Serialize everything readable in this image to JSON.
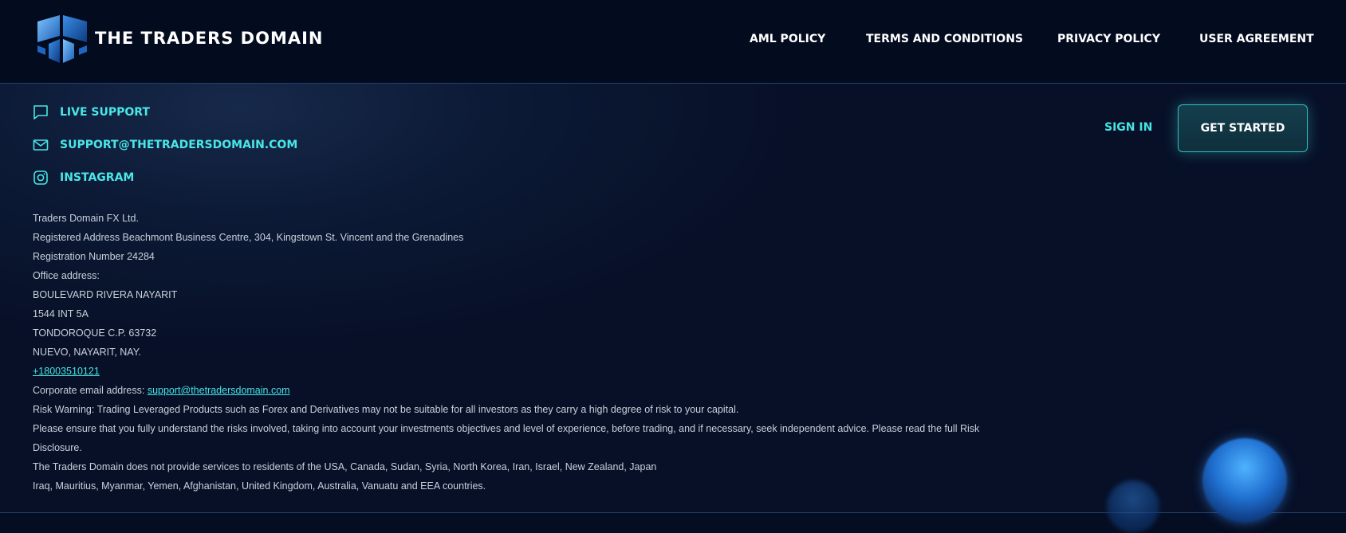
{
  "header": {
    "brand": "THE TRADERS DOMAIN",
    "nav": {
      "aml": "AML POLICY",
      "terms": "TERMS AND CONDITIONS",
      "privacy": "PRIVACY POLICY",
      "agreement": "USER AGREEMENT"
    }
  },
  "contacts": {
    "live_support": "LIVE SUPPORT",
    "email": "SUPPORT@THETRADERSDOMAIN.COM",
    "instagram": "INSTAGRAM"
  },
  "auth": {
    "sign_in": "SIGN IN",
    "get_started": "GET STARTED"
  },
  "company": {
    "name": "Traders Domain FX Ltd.",
    "registered_address": "Registered Address Beachmont Business Centre, 304, Kingstown St. Vincent and the Grenadines",
    "registration_number": "Registration Number 24284",
    "office_label": "Office address:",
    "office_line1": "BOULEVARD RIVERA NAYARIT",
    "office_line2": "1544 INT 5A",
    "office_line3": "TONDOROQUE C.P. 63732",
    "office_line4": "NUEVO, NAYARIT, NAY.",
    "phone": "+18003510121",
    "email_label": "Corporate email address: ",
    "email": "support@thetradersdomain.com",
    "risk_warning": "Risk Warning: Trading Leveraged Products such as Forex and Derivatives may not be suitable for all investors as they carry a high degree of risk to your capital.",
    "risk_advice_1": "Please ensure that you fully understand the risks involved, taking into account your investments objectives and level of experience, before trading, and if necessary, seek independent advice. Please read the full Risk",
    "risk_advice_2": "Disclosure.",
    "restriction_1": "The Traders Domain does not provide services to residents of the USA, Canada, Sudan, Syria, North Korea, Iran, Israel, New Zealand, Japan",
    "restriction_2": "Iraq, Mauritius, Myanmar, Yemen, Afghanistan, United Kingdom, Australia, Vanuatu and EEA countries."
  },
  "icons": {
    "logo": "cube-logo-icon",
    "live_support": "chat-bubble-icon",
    "email": "mail-icon",
    "instagram": "instagram-icon"
  },
  "colors": {
    "accent": "#46e4e4",
    "background": "#050d22",
    "text": "#c9d1dc"
  }
}
